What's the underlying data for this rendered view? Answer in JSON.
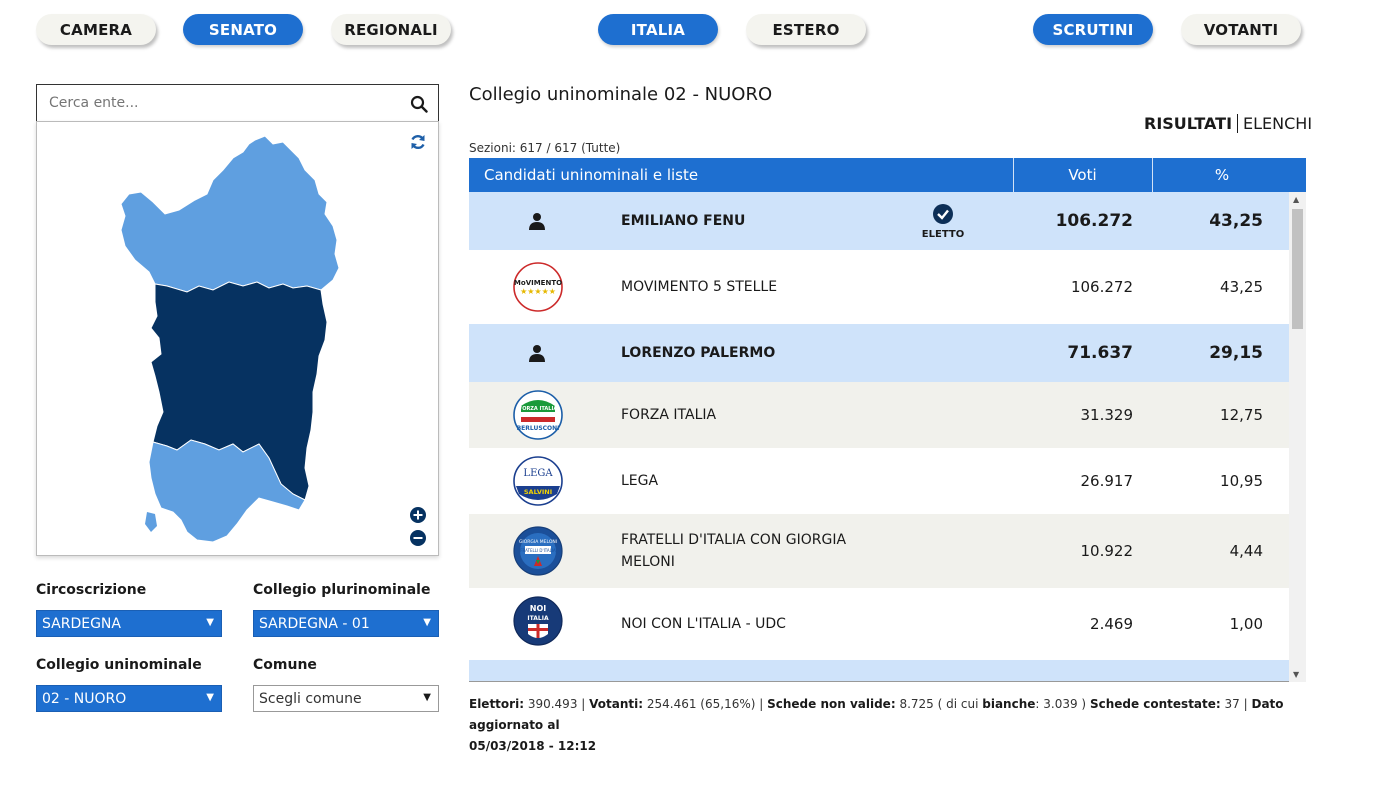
{
  "nav": {
    "camera": "CAMERA",
    "senato": "SENATO",
    "regionali": "REGIONALI",
    "italia": "ITALIA",
    "estero": "ESTERO",
    "scrutini": "SCRUTINI",
    "votanti": "VOTANTI"
  },
  "search": {
    "placeholder": "Cerca ente..."
  },
  "filters": {
    "circoscrizione_label": "Circoscrizione",
    "circoscrizione_value": "SARDEGNA",
    "plurinominale_label": "Collegio plurinominale",
    "plurinominale_value": "SARDEGNA - 01",
    "uninominale_label": "Collegio uninominale",
    "uninominale_value": "02 - NUORO",
    "comune_label": "Comune",
    "comune_value": "Scegli comune"
  },
  "main": {
    "title": "Collegio uninominale 02 - NUORO",
    "tab_risultati": "RISULTATI",
    "tab_elenchi": "ELENCHI",
    "sezioni": "Sezioni: 617 / 617 (Tutte)",
    "col_candidati": "Candidati uninominali e liste",
    "col_voti": "Voti",
    "col_pct": "%",
    "eletto": "ELETTO"
  },
  "rows": [
    {
      "kind": "cand",
      "name": "EMILIANO FENU",
      "votes": "106.272",
      "pct": "43,25"
    },
    {
      "kind": "list",
      "name": "MOVIMENTO 5 STELLE",
      "votes": "106.272",
      "pct": "43,25"
    },
    {
      "kind": "cand",
      "name": "LORENZO PALERMO",
      "votes": "71.637",
      "pct": "29,15"
    },
    {
      "kind": "list",
      "name": "FORZA ITALIA",
      "votes": "31.329",
      "pct": "12,75"
    },
    {
      "kind": "list",
      "name": "LEGA",
      "votes": "26.917",
      "pct": "10,95"
    },
    {
      "kind": "list",
      "name_line1": "FRATELLI D'ITALIA CON GIORGIA",
      "name_line2": "MELONI",
      "votes": "10.922",
      "pct": "4,44"
    },
    {
      "kind": "list",
      "name": "NOI CON L'ITALIA - UDC",
      "votes": "2.469",
      "pct": "1,00"
    }
  ],
  "logos": {
    "m5s_text": "MoVIMENTO",
    "fi_text1": "FORZA ITALIA",
    "fi_text2": "BERLUSCONI",
    "lega_text1": "LEGA",
    "lega_text2": "SALVINI",
    "fdi_text1": "GIORGIA MELONI",
    "fdi_text2": "FRATELLI D'ITALIA",
    "noi_text1": "NOI",
    "noi_text2": "ITALIA"
  },
  "footer": {
    "elettori_label": "Elettori:",
    "elettori_value": "390.493",
    "votanti_label": "Votanti:",
    "votanti_value": "254.461 (65,16%)",
    "nonvalide_label": "Schede non valide:",
    "nonvalide_value": "8.725 ( di cui",
    "bianche_label": "bianche",
    "bianche_value": ": 3.039 )",
    "contestate_label": "Schede contestate:",
    "contestate_value": "37",
    "aggiornato_label": "Dato aggiornato al",
    "aggiornato_value": "05/03/2018 - 12:12"
  },
  "colors": {
    "accent": "#1e6fd0",
    "map_dark": "#063261",
    "map_light": "#5f9fe0",
    "row_candidate": "#cfe3fa",
    "row_alt": "#f1f1ec"
  }
}
